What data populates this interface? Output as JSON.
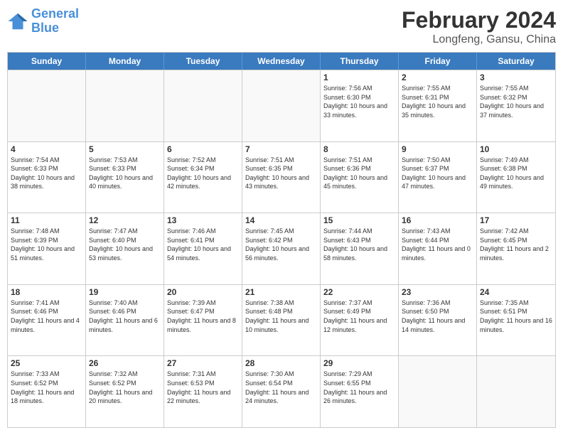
{
  "logo": {
    "line1": "General",
    "line2": "Blue"
  },
  "header": {
    "month": "February 2024",
    "location": "Longfeng, Gansu, China"
  },
  "weekdays": [
    "Sunday",
    "Monday",
    "Tuesday",
    "Wednesday",
    "Thursday",
    "Friday",
    "Saturday"
  ],
  "weeks": [
    [
      {
        "day": "",
        "sunrise": "",
        "sunset": "",
        "daylight": ""
      },
      {
        "day": "",
        "sunrise": "",
        "sunset": "",
        "daylight": ""
      },
      {
        "day": "",
        "sunrise": "",
        "sunset": "",
        "daylight": ""
      },
      {
        "day": "",
        "sunrise": "",
        "sunset": "",
        "daylight": ""
      },
      {
        "day": "1",
        "sunrise": "Sunrise: 7:56 AM",
        "sunset": "Sunset: 6:30 PM",
        "daylight": "Daylight: 10 hours and 33 minutes."
      },
      {
        "day": "2",
        "sunrise": "Sunrise: 7:55 AM",
        "sunset": "Sunset: 6:31 PM",
        "daylight": "Daylight: 10 hours and 35 minutes."
      },
      {
        "day": "3",
        "sunrise": "Sunrise: 7:55 AM",
        "sunset": "Sunset: 6:32 PM",
        "daylight": "Daylight: 10 hours and 37 minutes."
      }
    ],
    [
      {
        "day": "4",
        "sunrise": "Sunrise: 7:54 AM",
        "sunset": "Sunset: 6:33 PM",
        "daylight": "Daylight: 10 hours and 38 minutes."
      },
      {
        "day": "5",
        "sunrise": "Sunrise: 7:53 AM",
        "sunset": "Sunset: 6:33 PM",
        "daylight": "Daylight: 10 hours and 40 minutes."
      },
      {
        "day": "6",
        "sunrise": "Sunrise: 7:52 AM",
        "sunset": "Sunset: 6:34 PM",
        "daylight": "Daylight: 10 hours and 42 minutes."
      },
      {
        "day": "7",
        "sunrise": "Sunrise: 7:51 AM",
        "sunset": "Sunset: 6:35 PM",
        "daylight": "Daylight: 10 hours and 43 minutes."
      },
      {
        "day": "8",
        "sunrise": "Sunrise: 7:51 AM",
        "sunset": "Sunset: 6:36 PM",
        "daylight": "Daylight: 10 hours and 45 minutes."
      },
      {
        "day": "9",
        "sunrise": "Sunrise: 7:50 AM",
        "sunset": "Sunset: 6:37 PM",
        "daylight": "Daylight: 10 hours and 47 minutes."
      },
      {
        "day": "10",
        "sunrise": "Sunrise: 7:49 AM",
        "sunset": "Sunset: 6:38 PM",
        "daylight": "Daylight: 10 hours and 49 minutes."
      }
    ],
    [
      {
        "day": "11",
        "sunrise": "Sunrise: 7:48 AM",
        "sunset": "Sunset: 6:39 PM",
        "daylight": "Daylight: 10 hours and 51 minutes."
      },
      {
        "day": "12",
        "sunrise": "Sunrise: 7:47 AM",
        "sunset": "Sunset: 6:40 PM",
        "daylight": "Daylight: 10 hours and 53 minutes."
      },
      {
        "day": "13",
        "sunrise": "Sunrise: 7:46 AM",
        "sunset": "Sunset: 6:41 PM",
        "daylight": "Daylight: 10 hours and 54 minutes."
      },
      {
        "day": "14",
        "sunrise": "Sunrise: 7:45 AM",
        "sunset": "Sunset: 6:42 PM",
        "daylight": "Daylight: 10 hours and 56 minutes."
      },
      {
        "day": "15",
        "sunrise": "Sunrise: 7:44 AM",
        "sunset": "Sunset: 6:43 PM",
        "daylight": "Daylight: 10 hours and 58 minutes."
      },
      {
        "day": "16",
        "sunrise": "Sunrise: 7:43 AM",
        "sunset": "Sunset: 6:44 PM",
        "daylight": "Daylight: 11 hours and 0 minutes."
      },
      {
        "day": "17",
        "sunrise": "Sunrise: 7:42 AM",
        "sunset": "Sunset: 6:45 PM",
        "daylight": "Daylight: 11 hours and 2 minutes."
      }
    ],
    [
      {
        "day": "18",
        "sunrise": "Sunrise: 7:41 AM",
        "sunset": "Sunset: 6:46 PM",
        "daylight": "Daylight: 11 hours and 4 minutes."
      },
      {
        "day": "19",
        "sunrise": "Sunrise: 7:40 AM",
        "sunset": "Sunset: 6:46 PM",
        "daylight": "Daylight: 11 hours and 6 minutes."
      },
      {
        "day": "20",
        "sunrise": "Sunrise: 7:39 AM",
        "sunset": "Sunset: 6:47 PM",
        "daylight": "Daylight: 11 hours and 8 minutes."
      },
      {
        "day": "21",
        "sunrise": "Sunrise: 7:38 AM",
        "sunset": "Sunset: 6:48 PM",
        "daylight": "Daylight: 11 hours and 10 minutes."
      },
      {
        "day": "22",
        "sunrise": "Sunrise: 7:37 AM",
        "sunset": "Sunset: 6:49 PM",
        "daylight": "Daylight: 11 hours and 12 minutes."
      },
      {
        "day": "23",
        "sunrise": "Sunrise: 7:36 AM",
        "sunset": "Sunset: 6:50 PM",
        "daylight": "Daylight: 11 hours and 14 minutes."
      },
      {
        "day": "24",
        "sunrise": "Sunrise: 7:35 AM",
        "sunset": "Sunset: 6:51 PM",
        "daylight": "Daylight: 11 hours and 16 minutes."
      }
    ],
    [
      {
        "day": "25",
        "sunrise": "Sunrise: 7:33 AM",
        "sunset": "Sunset: 6:52 PM",
        "daylight": "Daylight: 11 hours and 18 minutes."
      },
      {
        "day": "26",
        "sunrise": "Sunrise: 7:32 AM",
        "sunset": "Sunset: 6:52 PM",
        "daylight": "Daylight: 11 hours and 20 minutes."
      },
      {
        "day": "27",
        "sunrise": "Sunrise: 7:31 AM",
        "sunset": "Sunset: 6:53 PM",
        "daylight": "Daylight: 11 hours and 22 minutes."
      },
      {
        "day": "28",
        "sunrise": "Sunrise: 7:30 AM",
        "sunset": "Sunset: 6:54 PM",
        "daylight": "Daylight: 11 hours and 24 minutes."
      },
      {
        "day": "29",
        "sunrise": "Sunrise: 7:29 AM",
        "sunset": "Sunset: 6:55 PM",
        "daylight": "Daylight: 11 hours and 26 minutes."
      },
      {
        "day": "",
        "sunrise": "",
        "sunset": "",
        "daylight": ""
      },
      {
        "day": "",
        "sunrise": "",
        "sunset": "",
        "daylight": ""
      }
    ]
  ]
}
